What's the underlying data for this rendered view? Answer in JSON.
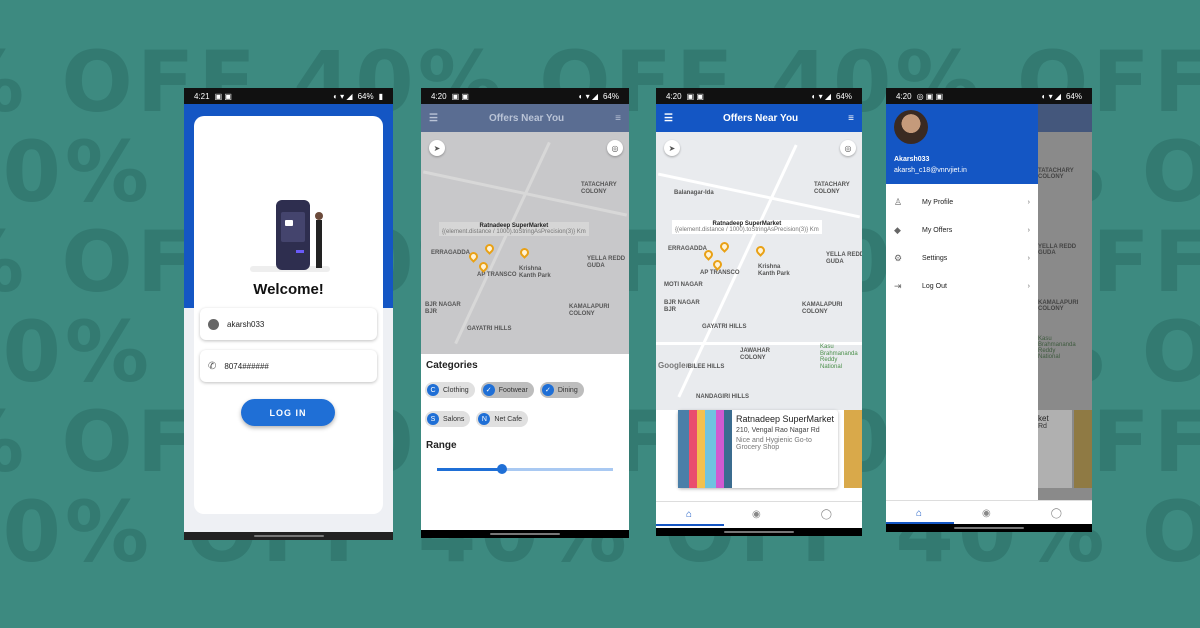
{
  "background": {
    "promo_text": "40% OFF",
    "lines": [
      "% OFF 40% OFF 40% OFF 40% OFF 40% OFF 40% OFF 40",
      "40% OFF 40% OFF 40% OFF 40% OFF 40% OFF 40% OFF",
      "% OFF 40% OFF 40% OFF 40% OFF 40% OFF 40% OFF 40",
      "40% OFF 40% OFF 40% OFF 40% OFF 40% OFF 40% OFF",
      "% OFF 40% OFF 40% OFF 40% OFF 40% OFF 40% OFF 40",
      "40% OFF 40% OFF 40% OFF 40% OFF 40% OFF 40% OFF"
    ],
    "color": "#3d8a80"
  },
  "colors": {
    "primary": "#1456c4",
    "pin": "#e9a115",
    "button": "#1f6fd6"
  },
  "status": {
    "s1": {
      "time": "4:21",
      "battery": "64%"
    },
    "s2": {
      "time": "4:20",
      "battery": "64%"
    },
    "s3": {
      "time": "4:20",
      "battery": "64%"
    },
    "s4": {
      "time": "4:20",
      "battery": "64%"
    }
  },
  "login": {
    "welcome": "Welcome!",
    "username": "akarsh033",
    "phone": "8074######",
    "button": "LOG IN"
  },
  "offers": {
    "title": "Offers Near You",
    "map_labels": {
      "balanagar": "Balanagar-Ida",
      "tatachary": "TATACHARY\nCOLONY",
      "erragadda": "ERRAGADDA",
      "yella": "YELLA REDD\nGUDA",
      "aptransco": "AP TRANSCO",
      "krishna": "Krishna\nKanth Park",
      "moti": "MOTI NAGAR",
      "bjr": "BJR NAGAR\nBJR",
      "kamalapuri": "KAMALAPURI\nCOLONY",
      "gayatri": "GAYATRI HILLS",
      "jawahar": "JAWAHAR\nCOLONY",
      "kasu": "Kasu\nBrahmananda\nReddy\nNational",
      "jubilee": "JUBILEE HILLS",
      "nandagiri": "NANDAGIRI HILLS",
      "google": "Google"
    },
    "tooltip_title": "Ratnadeep SuperMarket",
    "tooltip_sub": "{(element.distance / 1000).toStringAsPrecision(3)} Km",
    "categories_title": "Categories",
    "categories": [
      {
        "letter": "C",
        "label": "Clothing",
        "selected": false
      },
      {
        "letter": "✓",
        "label": "Footwear",
        "selected": true
      },
      {
        "letter": "✓",
        "label": "Dining",
        "selected": true
      },
      {
        "letter": "S",
        "label": "Salons",
        "selected": false
      },
      {
        "letter": "N",
        "label": "Net Cafe",
        "selected": false
      }
    ],
    "range_title": "Range",
    "range_value_fraction": 0.37
  },
  "card": {
    "name": "Ratnadeep SuperMarket",
    "address": "210, Vengal Rao Nagar Rd",
    "desc": "Nice and Hygienic Go-to\nGrocery Shop"
  },
  "drawer": {
    "user": "Akarsh033",
    "email": "akarsh_c18@vnrvjiet.in",
    "items": [
      {
        "icon": "person-icon",
        "label": "My Profile"
      },
      {
        "icon": "tag-icon",
        "label": "My Offers"
      },
      {
        "icon": "gear-icon",
        "label": "Settings"
      },
      {
        "icon": "logout-icon",
        "label": "Log Out"
      }
    ],
    "peek_card_title": "ket",
    "peek_card_sub": "Rd"
  }
}
